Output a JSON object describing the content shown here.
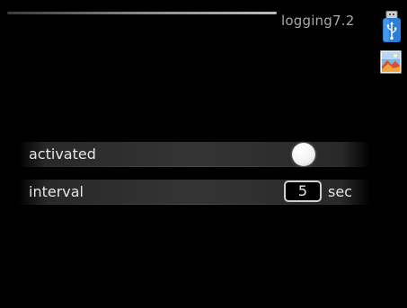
{
  "header": {
    "title": "logging",
    "menu_number": "7.2"
  },
  "icons": {
    "top_right": "usb-icon",
    "below": "picture-icon"
  },
  "settings": [
    {
      "label": "activated",
      "control": "toggle",
      "state": "on"
    },
    {
      "label": "interval",
      "control": "number",
      "value": "5",
      "unit": "sec"
    }
  ],
  "colors": {
    "background": "#000000",
    "text": "#e6e6e6",
    "usb_blue": "#2a7fd6",
    "toggle_knob": "#ffffff"
  }
}
